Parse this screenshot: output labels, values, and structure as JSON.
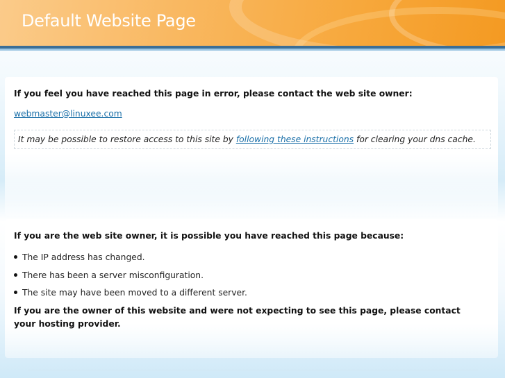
{
  "header": {
    "title": "Default Website Page"
  },
  "error_panel": {
    "heading": "If you feel you have reached this page in error, please contact the web site owner:",
    "email": "webmaster@linuxee.com",
    "notice_before": "It may be possible to restore access to this site by ",
    "notice_link": "following these instructions",
    "notice_after": " for clearing your dns cache."
  },
  "owner_panel": {
    "heading": "If you are the web site owner, it is possible you have reached this page because:",
    "reasons": [
      "The IP address has changed.",
      "There has been a server misconfiguration.",
      "The site may have been moved to a different server."
    ],
    "footer": "If you are the owner of this website and were not expecting to see this page, please contact your hosting provider."
  },
  "colors": {
    "header_orange": "#f7a83c",
    "bar_blue": "#3b6e97",
    "link_blue": "#1a6fa8"
  }
}
